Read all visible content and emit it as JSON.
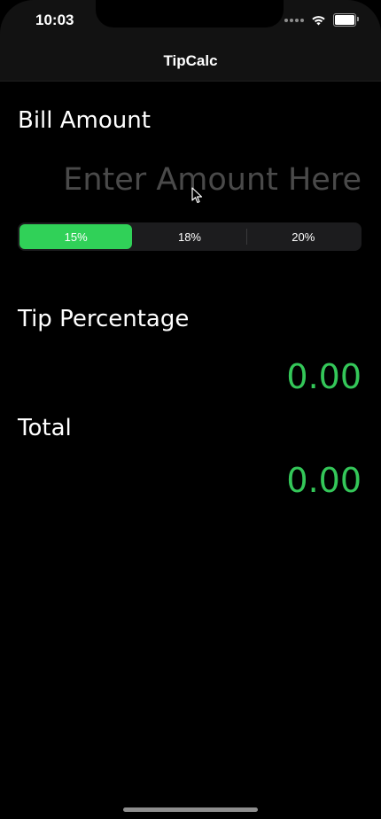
{
  "status_bar": {
    "time": "10:03",
    "signal_icon": "cellular-dots-icon",
    "wifi_icon": "wifi-icon",
    "battery_icon": "battery-icon"
  },
  "nav": {
    "title": "TipCalc"
  },
  "bill": {
    "label": "Bill Amount",
    "input_value": "",
    "input_placeholder": "Enter Amount Here"
  },
  "tip_options": {
    "selected_index": 0,
    "items": [
      {
        "label": "15%"
      },
      {
        "label": "18%"
      },
      {
        "label": "20%"
      }
    ],
    "accent_color": "#30d158"
  },
  "tip": {
    "label": "Tip Percentage",
    "value": "0.00"
  },
  "total": {
    "label": "Total",
    "value": "0.00"
  },
  "colors": {
    "background": "#000000",
    "value_green": "#34c759",
    "placeholder_gray": "#4a4a4a"
  }
}
